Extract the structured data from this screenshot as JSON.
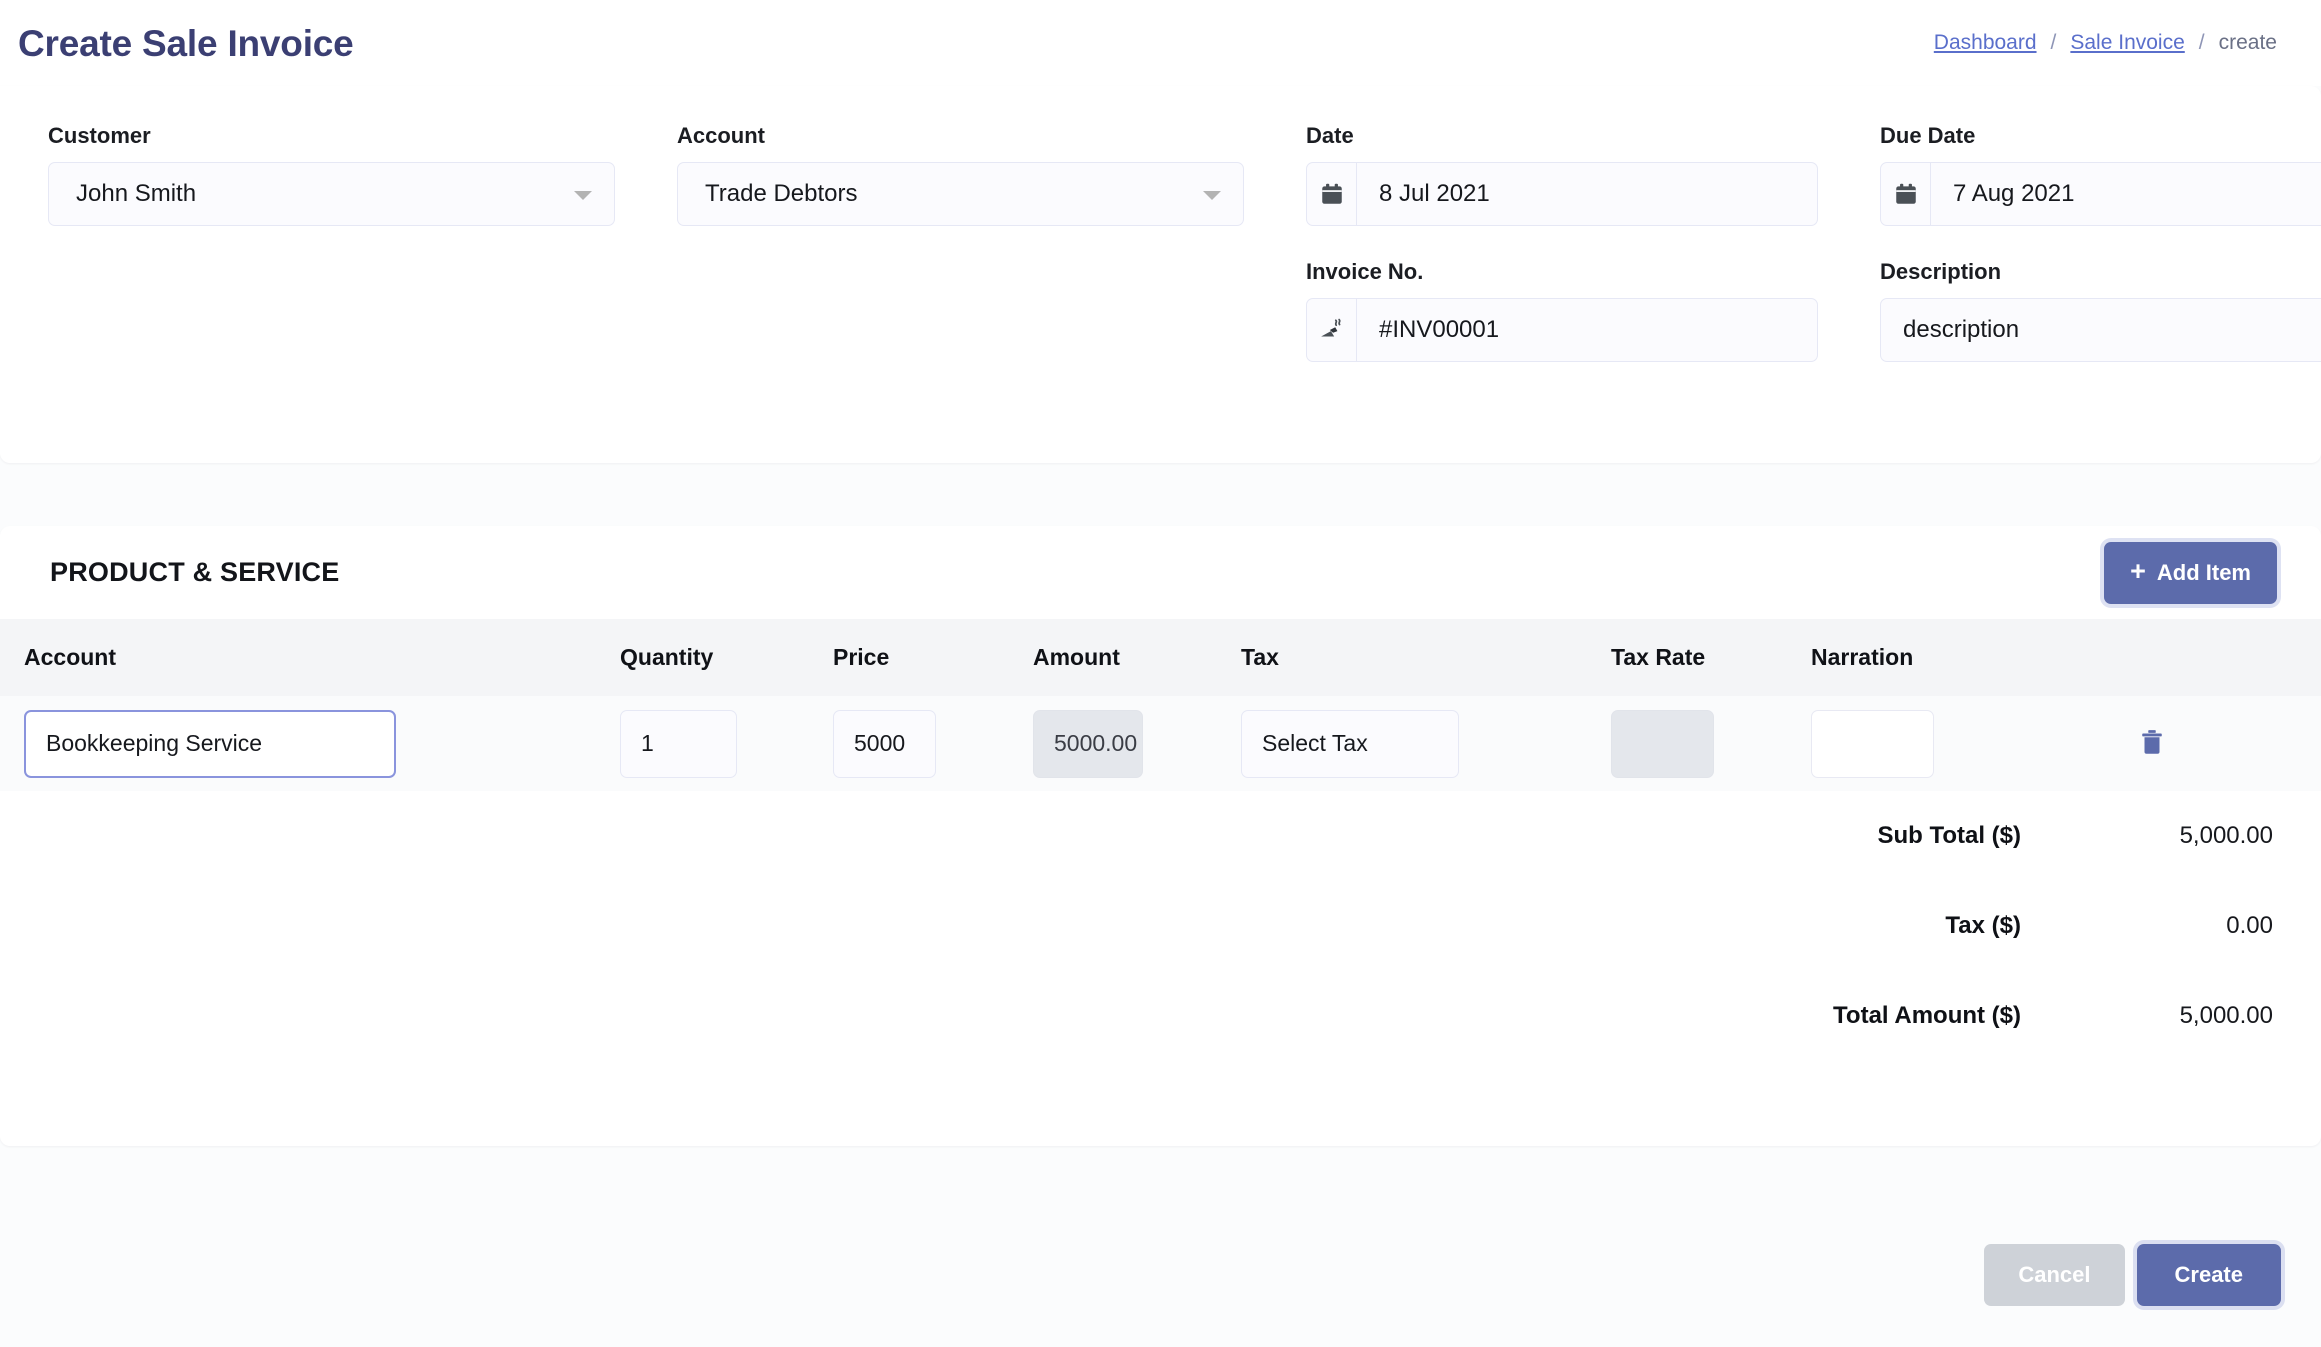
{
  "header": {
    "title": "Create Sale Invoice",
    "breadcrumb": {
      "item1": "Dashboard",
      "sep1": "/",
      "item2": "Sale Invoice",
      "sep2": "/",
      "current": "create"
    }
  },
  "form": {
    "customer": {
      "label": "Customer",
      "value": "John Smith",
      "icon": "chevron-down-icon"
    },
    "account": {
      "label": "Account",
      "value": "Trade Debtors",
      "icon": "chevron-down-icon"
    },
    "date": {
      "label": "Date",
      "value": "8 Jul 2021",
      "icon": "calendar-icon"
    },
    "due_date": {
      "label": "Due Date",
      "value": "7 Aug 2021",
      "icon": "calendar-icon"
    },
    "invoice_no": {
      "label": "Invoice No.",
      "value": "#INV00001",
      "icon": "receipt-icon"
    },
    "description": {
      "label": "Description",
      "value": "description",
      "placeholder": "description"
    }
  },
  "product_service": {
    "title": "PRODUCT & SERVICE",
    "add_item_button": "Add Item",
    "add_item_icon": "plus-icon",
    "columns": [
      "Account",
      "Quantity",
      "Price",
      "Amount",
      "Tax",
      "Tax Rate",
      "Narration"
    ],
    "rows": [
      {
        "account": "Bookkeeping Service",
        "quantity": "1",
        "price": "5000",
        "amount": "5000.00",
        "tax": "Select Tax",
        "tax_rate": "",
        "narration": "",
        "delete_icon": "trash-icon"
      }
    ],
    "totals": [
      {
        "label": "Sub Total ($)",
        "value": "5,000.00"
      },
      {
        "label": "Tax ($)",
        "value": "0.00"
      },
      {
        "label": "Total Amount ($)",
        "value": "5,000.00"
      }
    ]
  },
  "footer": {
    "cancel_label": "Cancel",
    "create_label": "Create"
  },
  "colors": {
    "title": "#3b3f73",
    "link": "#5a6fcb",
    "primary_button": "#5c6bab",
    "cancel_button": "#ced2d8",
    "table_header_bg": "#f4f5f7",
    "row_bg": "#fafbfc",
    "disabled_bg": "#e4e7ec",
    "page_bg": "#fbfcfd"
  }
}
